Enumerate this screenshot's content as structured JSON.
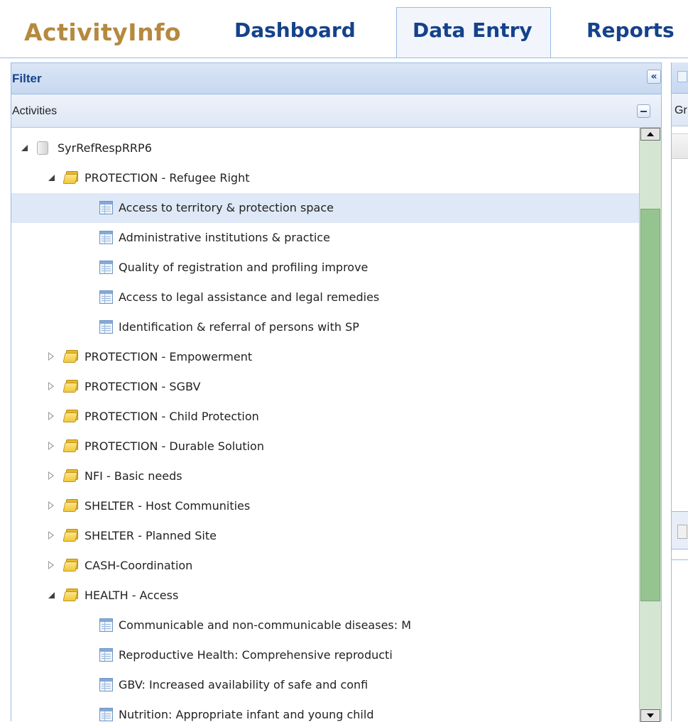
{
  "app": {
    "logo": "ActivityInfo",
    "nav_tabs": [
      {
        "label": "Dashboard",
        "active": false
      },
      {
        "label": "Data Entry",
        "active": true
      },
      {
        "label": "Reports",
        "active": false
      }
    ]
  },
  "filter_panel": {
    "title": "Filter",
    "collapse_icon": "double-chevron-left-icon",
    "section_title": "Activities",
    "tree": [
      {
        "level": 0,
        "kind": "database",
        "expander": "open",
        "label": "SyrRefRespRRP6"
      },
      {
        "level": 1,
        "kind": "folder",
        "expander": "open",
        "label": "PROTECTION - Refugee Right"
      },
      {
        "level": 2,
        "kind": "form",
        "label": "Access to territory & protection space",
        "selected": true
      },
      {
        "level": 2,
        "kind": "form",
        "label": "Administrative institutions & practice"
      },
      {
        "level": 2,
        "kind": "form",
        "label": "Quality of registration and profiling improve"
      },
      {
        "level": 2,
        "kind": "form",
        "label": "Access to legal assistance and legal remedies"
      },
      {
        "level": 2,
        "kind": "form",
        "label": "Identification & referral of persons with SP"
      },
      {
        "level": 1,
        "kind": "folder",
        "expander": "closed",
        "label": "PROTECTION - Empowerment"
      },
      {
        "level": 1,
        "kind": "folder",
        "expander": "closed",
        "label": "PROTECTION - SGBV"
      },
      {
        "level": 1,
        "kind": "folder",
        "expander": "closed",
        "label": "PROTECTION - Child Protection"
      },
      {
        "level": 1,
        "kind": "folder",
        "expander": "closed",
        "label": "PROTECTION - Durable Solution"
      },
      {
        "level": 1,
        "kind": "folder",
        "expander": "closed",
        "label": "NFI - Basic needs"
      },
      {
        "level": 1,
        "kind": "folder",
        "expander": "closed",
        "label": "SHELTER - Host Communities"
      },
      {
        "level": 1,
        "kind": "folder",
        "expander": "closed",
        "label": "SHELTER - Planned Site"
      },
      {
        "level": 1,
        "kind": "folder",
        "expander": "closed",
        "label": "CASH-Coordination"
      },
      {
        "level": 1,
        "kind": "folder",
        "expander": "open",
        "label": "HEALTH - Access"
      },
      {
        "level": 2,
        "kind": "form",
        "label": "Communicable and non-communicable diseases: M"
      },
      {
        "level": 2,
        "kind": "form",
        "label": "Reproductive Health: Comprehensive reproducti"
      },
      {
        "level": 2,
        "kind": "form",
        "label": "GBV: Increased availability of safe and confi"
      },
      {
        "level": 2,
        "kind": "form",
        "label": "Nutrition: Appropriate infant and young child"
      }
    ],
    "scroll": {
      "thumb_start_fraction": 0.12,
      "thumb_length_fraction": 0.69
    }
  },
  "right_panel": {
    "section_title_partial": "Gr"
  }
}
